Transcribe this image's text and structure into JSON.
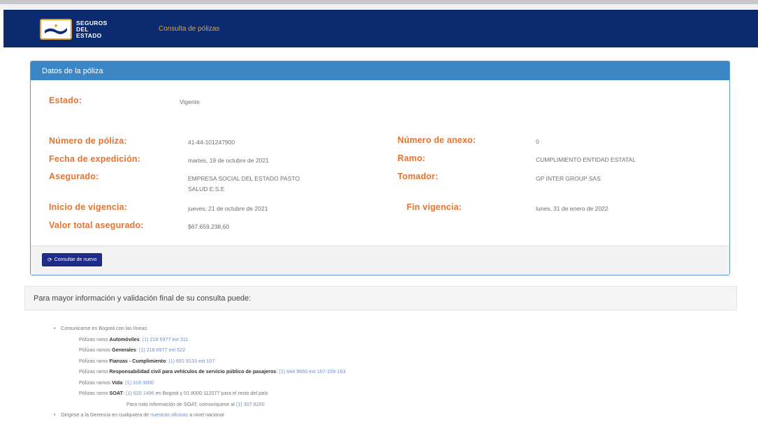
{
  "navbar": {
    "logo_text": [
      "SEGUROS",
      "DEL",
      "ESTADO"
    ],
    "link": "Consulta de pólizas"
  },
  "policy": {
    "panel_title": "Datos de la póliza",
    "estado": {
      "label": "Estado:",
      "value": "Vigente"
    },
    "numero_poliza": {
      "label": "Número de póliza:",
      "value": "41-44-101247900"
    },
    "numero_anexo": {
      "label": "Número de anexo:",
      "value": "0"
    },
    "fecha_expedicion": {
      "label": "Fecha de expedición:",
      "value": "martes, 19 de octubre de 2021"
    },
    "ramo": {
      "label": "Ramo:",
      "value": "CUMPLIMIENTO ENTIDAD ESTATAL"
    },
    "asegurado": {
      "label": "Asegurado:",
      "value_line1": "EMPRESA SOCIAL DEL ESTADO PASTO",
      "value_line2": "SALUD E.S.E"
    },
    "tomador": {
      "label": "Tomador:",
      "value": "GP INTER GROUP SAS"
    },
    "inicio_vigencia": {
      "label": "Inicio de vigencia:",
      "value": "jueves, 21 de octubre de 2021"
    },
    "fin_vigencia": {
      "label": "Fin vigencia:",
      "value": "lunes, 31 de enero de 2022"
    },
    "valor_total": {
      "label": "Valor total asegurado:",
      "value": "$67.659.238,60"
    },
    "button_label": "Consultar de nuevo"
  },
  "info": {
    "heading": "Para mayor información y validación final de su consulta puede:",
    "bullet1": "Comunicarse en Bogotá con las líneas:",
    "lines": [
      {
        "prefix": "Pólizas ramo ",
        "bold": "Automóviles",
        "sep": ": ",
        "phone": "(1) 218 6977 ext 311",
        "suffix": ""
      },
      {
        "prefix": "Pólizas ramos ",
        "bold": "Generales",
        "sep": ": ",
        "phone": "(1) 218 6977 ext 522",
        "suffix": ""
      },
      {
        "prefix": "Pólizas ramo ",
        "bold": "Fianzas - Cumplimiento",
        "sep": ": ",
        "phone": "(1) 691 9133 ext 107",
        "suffix": ""
      },
      {
        "prefix": "Pólizas ramo ",
        "bold": "Responsabilidad civil para vehículos de servicio público de pasajeros",
        "sep": ": ",
        "phone": "(1) 644 9660 ext 157-159-163",
        "suffix": ""
      },
      {
        "prefix": "Pólizas ramos ",
        "bold": "Vida",
        "sep": ": ",
        "phone": "(1) 318 3800",
        "suffix": ""
      },
      {
        "prefix": "Pólizas ramo ",
        "bold": "SOAT",
        "sep": ": ",
        "phone": "(1) 620 1496",
        "suffix": " en Bogotá y 01 8000 112077 para el resto del país"
      }
    ],
    "soat_more_prefix": "Para más información de SOAT, comuníquese al ",
    "soat_more_phone": "(1) 307 8200",
    "bullet2_prefix": "Dirigirse a la Gerencia en cualquiera de ",
    "bullet2_link": "nuestras oficinas",
    "bullet2_suffix": " a nivel nacional"
  },
  "colors": {
    "navbar": "#0b2a6f",
    "nav_link": "#e8a427",
    "panel_header": "#3d86c6",
    "label": "#e8722c",
    "button": "#1f2d8a",
    "phone_link": "#6d8fd0"
  }
}
